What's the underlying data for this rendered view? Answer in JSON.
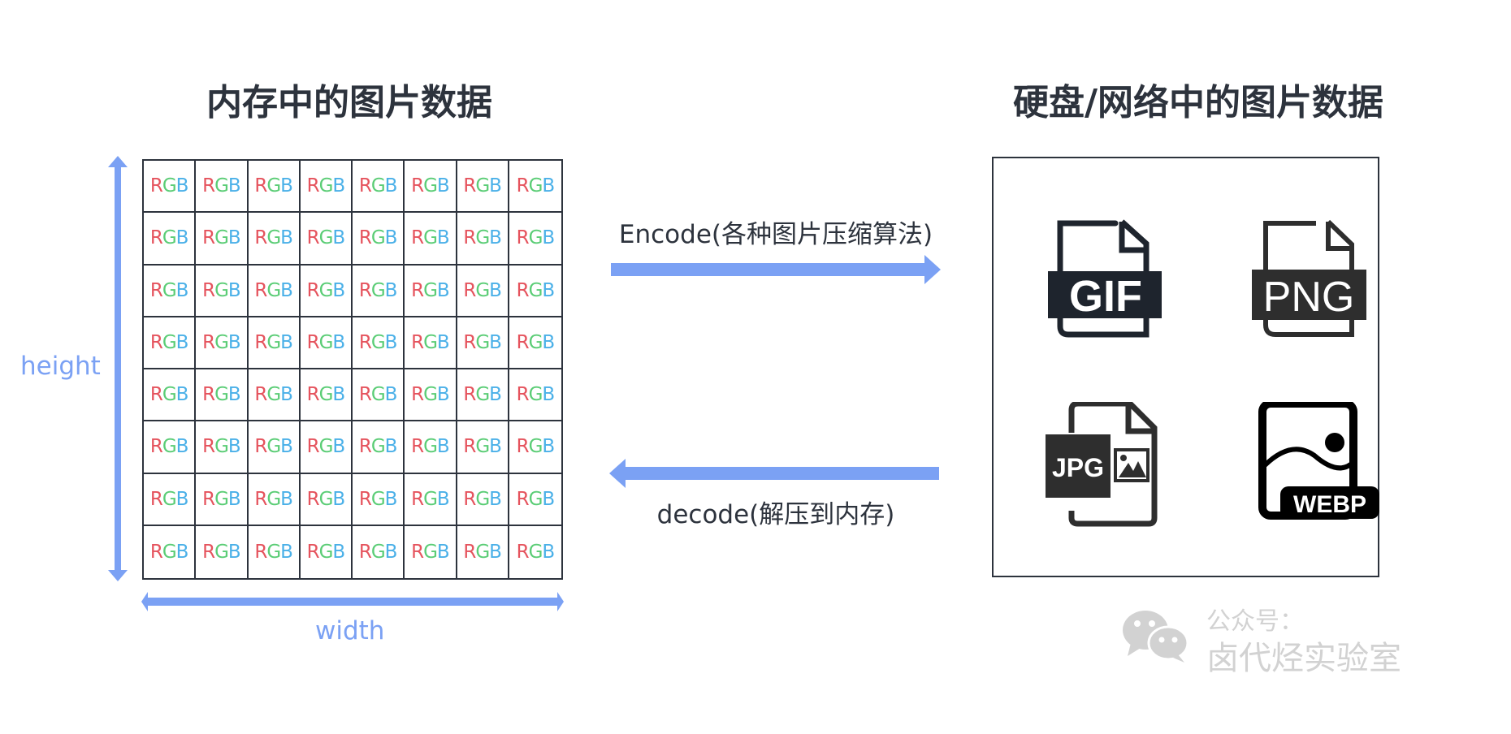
{
  "titles": {
    "memory": "内存中的图片数据",
    "storage": "硬盘/网络中的图片数据"
  },
  "pixel_grid": {
    "rows": 8,
    "cols": 8,
    "cell_text": [
      "R",
      "G",
      "B"
    ],
    "colors": {
      "r": "#e5535d",
      "g": "#5bcd76",
      "b": "#4ab0e8"
    }
  },
  "axes": {
    "height_label": "height",
    "width_label": "width",
    "color": "#7ba1f4"
  },
  "flows": {
    "encode_label": "Encode(各种图片压缩算法)",
    "decode_label": "decode(解压到内存)",
    "arrow_color": "#7ba1f4"
  },
  "formats": [
    {
      "name": "GIF"
    },
    {
      "name": "PNG"
    },
    {
      "name": "JPG"
    },
    {
      "name": "WEBP"
    }
  ],
  "watermark": {
    "line1": "公众号：",
    "line2": "卤代烃实验室",
    "icon": "wechat-icon"
  }
}
